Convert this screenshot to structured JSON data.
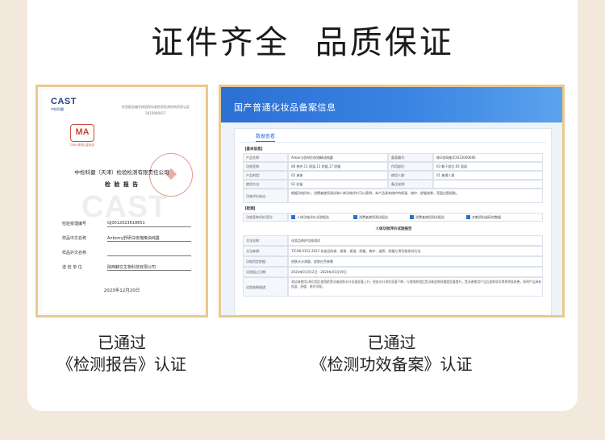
{
  "page": {
    "title": "证件齐全  品质保证"
  },
  "left_card": {
    "caption_line1": "已通过",
    "caption_line2": "《检测报告》认证",
    "doc": {
      "logo_text": "CAST",
      "logo_sub": "中检科健",
      "top_note": "检验报告编号按国家标准检验检测机构资质认定",
      "top_number": "2019000417",
      "ma_text": "MA",
      "ma_sub": "CMA 资质认定标志",
      "org": "中检科健（天津）检验检测有限责任公司",
      "heading": "检 验 报 告",
      "watermark": "CAST",
      "rows": [
        {
          "label": "检验受理编号",
          "value": "GJ0012023618651"
        },
        {
          "label": "样品中文名称",
          "value": "Anborry舒研白玫瑰精油纯露"
        },
        {
          "label": "样品外文名称",
          "value": ""
        },
        {
          "label": "送  检  单  位",
          "value": "陕西麒文生物科技有限公司"
        }
      ],
      "date": "2023年12月20日"
    }
  },
  "right_card": {
    "caption_line1": "已通过",
    "caption_line2": "《检测功效备案》认证",
    "filing": {
      "header_title": "国产普通化妆品备案信息",
      "tab_label": "数据查看",
      "basic_section": "【基本信息】",
      "basic_rows": [
        [
          "产品名称:",
          "Anborry舒研白玫瑰精油纯露",
          "备案编号:",
          "陕G妆网备字2023000666"
        ],
        [
          "功效宣称:",
          "08 修护,11 保湿,13 舒缓,17 舒缓",
          "作用部位:",
          "03 躯干部位,05 面部"
        ],
        [
          "产品剂型:",
          "02 液体",
          "使用人群:",
          "01 普通人群"
        ],
        [
          "使用方法:",
          "02 驻留",
          "备注说明:",
          ""
        ],
        [
          "功效评价结论:",
          "根据功效评价，消费者使用测试和人体功效评价可以表明，本产品具有修护的保湿、修护、舒缓效果，亮面白皙肌肤。",
          "",
          ""
        ]
      ],
      "eval_section": "【检测】",
      "eval_label": "功效宣称评价项目:",
      "eval_checks": [
        "人体功效评价试验报告",
        "消费者使用测试报告",
        "消费者使用测试报告",
        "文献资料或研究数据"
      ],
      "sub_title": "人体功效评价试验报告",
      "detail_rows": [
        {
          "label": "方法名称:",
          "value": "化妆品修护功效测试"
        },
        {
          "label": "方法来源:",
          "value": "T/CAB 0152-2022 化妆品的紧、紧致、保湿、舒缓、修护、滋养、舒缓七项功效测试方法"
        },
        {
          "label": "功效判定依据:",
          "value": "经肤水分测量，皮肤红色参数"
        },
        {
          "label": "试验起止日期:",
          "value": "2024年01月12日 - 2024年01月19日"
        },
        {
          "label": "试验结果描述:",
          "value": "测试者使用2周后相比使用前受试者皮肤水分含量显著上升，经皮水分流失显著下降，与使用前相比受试者皮肤舒缓度显著提升，受试者使用产品后皮肤状况得到明显改善，表明产品具有保湿、舒缓、修护功效。"
        }
      ]
    }
  }
}
